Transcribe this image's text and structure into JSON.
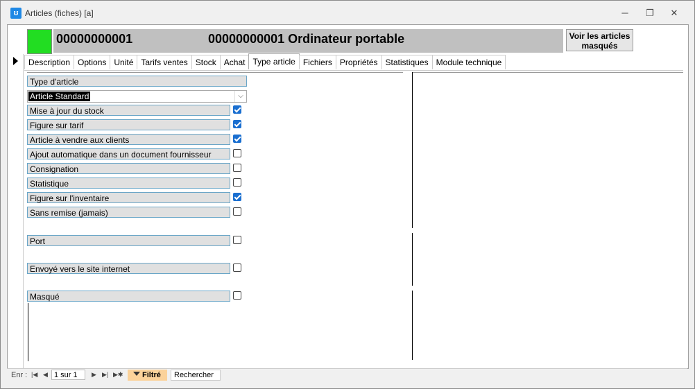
{
  "window": {
    "title": "Articles (fiches) [a]",
    "minimize": "─",
    "restore": "❐",
    "close": "✕"
  },
  "header": {
    "code": "00000000001",
    "name": "00000000001 Ordinateur portable",
    "voir_button_line1": "Voir les articles",
    "voir_button_line2": "masqués",
    "status_color": "#22dd22"
  },
  "tabs": [
    {
      "label": "Description"
    },
    {
      "label": "Options"
    },
    {
      "label": "Unité"
    },
    {
      "label": "Tarifs ventes"
    },
    {
      "label": "Stock"
    },
    {
      "label": "Achat"
    },
    {
      "label": "Type article"
    },
    {
      "label": "Fichiers"
    },
    {
      "label": "Propriétés"
    },
    {
      "label": "Statistiques"
    },
    {
      "label": "Module technique"
    }
  ],
  "active_tab": "Type article",
  "form": {
    "type_label": "Type d'article",
    "type_value": "Article Standard",
    "fields": [
      {
        "label": "Mise à jour du stock",
        "checked": true
      },
      {
        "label": "Figure sur tarif",
        "checked": true
      },
      {
        "label": "Article à vendre aux clients",
        "checked": true
      },
      {
        "label": "Ajout automatique dans un document fournisseur",
        "checked": false
      },
      {
        "label": "Consignation",
        "checked": false
      },
      {
        "label": "Statistique",
        "checked": false
      },
      {
        "label": "Figure sur l'inventaire",
        "checked": true
      },
      {
        "label": "Sans remise (jamais)",
        "checked": false
      },
      {
        "label": "Port",
        "checked": false
      },
      {
        "label": "Envoyé vers le site internet",
        "checked": false
      },
      {
        "label": "Masqué",
        "checked": false
      }
    ]
  },
  "navigation": {
    "label": "Enr :",
    "record": "1 sur 1",
    "first": "|◀",
    "prev": "◀",
    "next": "▶",
    "last": "▶|",
    "new": "▶✱",
    "filter": "Filtré",
    "search": "Rechercher"
  },
  "colors": {
    "accent": "#1a6fd0",
    "filter": "#fbd29a"
  }
}
